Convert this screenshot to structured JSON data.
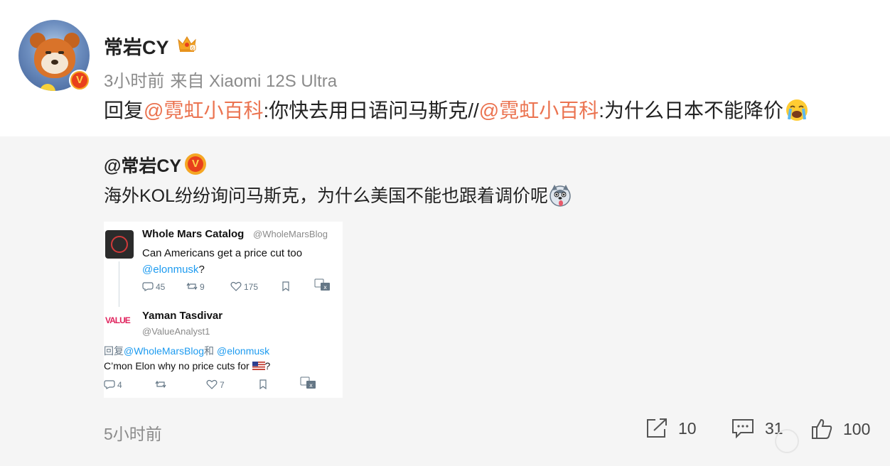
{
  "colors": {
    "mention": "#eb7350",
    "link": "#1d9bf0",
    "vbadge": "#e8401c",
    "muted": "#8b8b8b",
    "retweet_bg": "#f5f5f5"
  },
  "post": {
    "username": "常岩CY",
    "time": "3小时前",
    "source": "来自 Xiaomi 12S Ultra",
    "reply_prefix": "回复",
    "mention1": "@霓虹小百科",
    "text1": ":你快去用日语问马斯克//",
    "mention2": "@霓虹小百科",
    "text2": ":为什么日本不能降价",
    "badge_letter": "V"
  },
  "retweet": {
    "username": "@常岩CY",
    "text": "海外KOL纷纷询问马斯克，为什么美国不能也跟着调价呢",
    "time": "5小时前"
  },
  "tweet1": {
    "name": "Whole Mars Catalog",
    "handle": "@WholeMarsBlog",
    "text": "Can Americans get a price cut too",
    "link": "@elonmusk",
    "text_end": "?",
    "replies": "45",
    "retweets": "9",
    "likes": "175"
  },
  "tweet2": {
    "name": "Yaman Tasdivar",
    "handle": "@ValueAnalyst1",
    "avatar_text": "VALUE",
    "reply_prefix": "回复",
    "reply_to1": "@WholeMarsBlog",
    "reply_and": "和",
    "reply_to2": "@elonmusk",
    "text": "C’mon Elon why no price cuts for",
    "text_end": "?",
    "replies": "4",
    "likes": "7"
  },
  "actions": {
    "share_count": "10",
    "comment_count": "31",
    "like_count": "100"
  }
}
